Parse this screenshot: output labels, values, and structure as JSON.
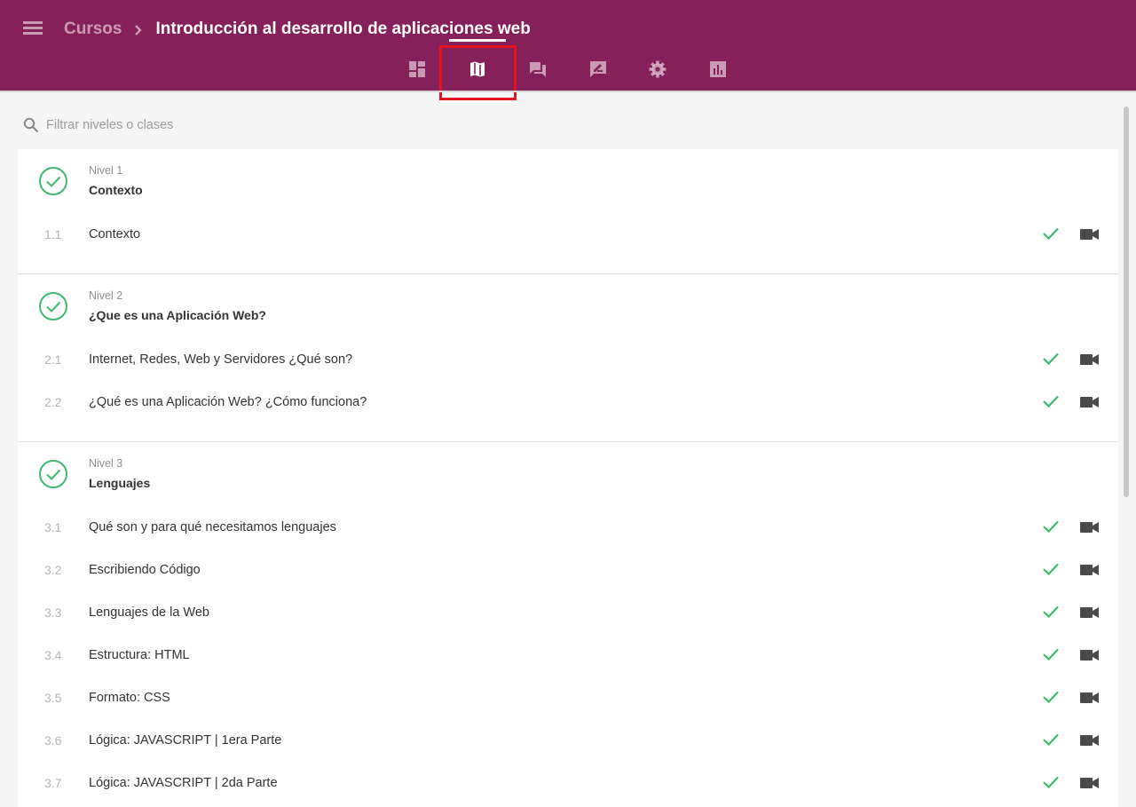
{
  "header": {
    "menu_icon": "hamburger-menu-icon",
    "breadcrumb_root": "Cursos",
    "course_title": "Introducción al desarrollo de aplicaciones web",
    "brand_color": "#86205a"
  },
  "tabs": [
    {
      "icon": "dashboard-icon",
      "active": false
    },
    {
      "icon": "map-icon",
      "active": true
    },
    {
      "icon": "forum-icon",
      "active": false
    },
    {
      "icon": "rate-review-icon",
      "active": false
    },
    {
      "icon": "settings-gear-icon",
      "active": false
    },
    {
      "icon": "assessment-chart-icon",
      "active": false
    }
  ],
  "search": {
    "placeholder": "Filtrar niveles o clases",
    "icon": "search-icon"
  },
  "levels": [
    {
      "label": "Nivel 1",
      "title": "Contexto",
      "completed": true,
      "lessons": [
        {
          "number": "1.1",
          "title": "Contexto",
          "completed": true,
          "type": "video"
        }
      ]
    },
    {
      "label": "Nivel 2",
      "title": "¿Que es una Aplicación Web?",
      "completed": true,
      "lessons": [
        {
          "number": "2.1",
          "title": "Internet, Redes, Web y Servidores ¿Qué son?",
          "completed": true,
          "type": "video"
        },
        {
          "number": "2.2",
          "title": "¿Qué es una Aplicación Web? ¿Cómo funciona?",
          "completed": true,
          "type": "video"
        }
      ]
    },
    {
      "label": "Nivel 3",
      "title": "Lenguajes",
      "completed": true,
      "lessons": [
        {
          "number": "3.1",
          "title": "Qué son y para qué necesitamos lenguajes",
          "completed": true,
          "type": "video"
        },
        {
          "number": "3.2",
          "title": "Escribiendo Código",
          "completed": true,
          "type": "video"
        },
        {
          "number": "3.3",
          "title": "Lenguajes de la Web",
          "completed": true,
          "type": "video"
        },
        {
          "number": "3.4",
          "title": "Estructura: HTML",
          "completed": true,
          "type": "video"
        },
        {
          "number": "3.5",
          "title": "Formato: CSS",
          "completed": true,
          "type": "video"
        },
        {
          "number": "3.6",
          "title": "Lógica: JAVASCRIPT | 1era Parte",
          "completed": true,
          "type": "video"
        },
        {
          "number": "3.7",
          "title": "Lógica: JAVASCRIPT | 2da Parte",
          "completed": true,
          "type": "video"
        }
      ]
    }
  ],
  "colors": {
    "check_green": "#3dba6f",
    "video_icon": "#4a4a4a",
    "highlight_red": "#e4151f"
  }
}
